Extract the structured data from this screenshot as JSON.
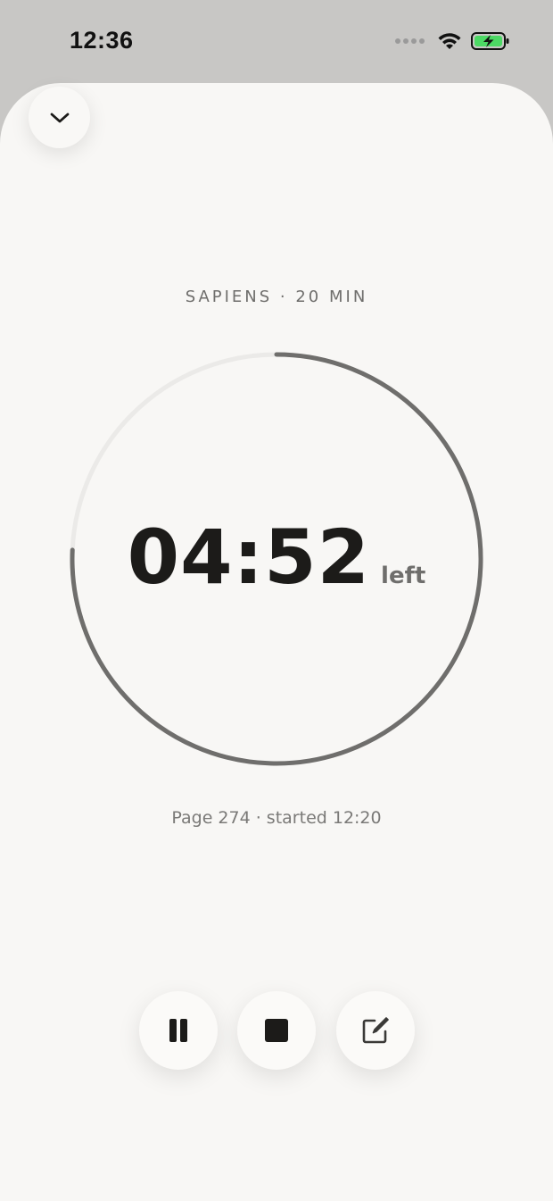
{
  "status_bar": {
    "time": "12:36",
    "battery_color": "#4cd964"
  },
  "session": {
    "title": "SAPIENS · 20 MIN",
    "remaining": "04:52",
    "remaining_unit": "left",
    "meta": "Page 274 · started 12:20",
    "progress_remaining_fraction": 0.243
  },
  "controls": {
    "collapse": "chevron-down-icon",
    "pause": "pause-icon",
    "stop": "stop-icon",
    "note": "edit-note-icon"
  },
  "colors": {
    "sheet_bg": "#f8f7f5",
    "ring_track": "#ebeae8",
    "ring_progress": "#6f6e6c",
    "text_primary": "#1c1b19"
  }
}
